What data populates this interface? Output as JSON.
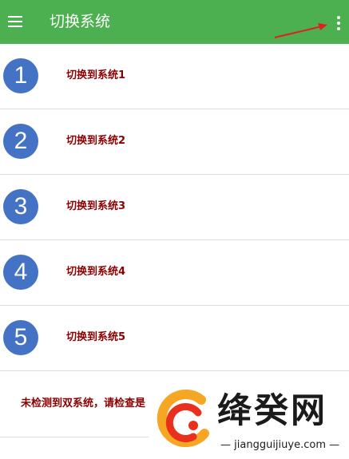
{
  "appbar": {
    "title": "切换系统",
    "menu_icon": "menu-icon",
    "overflow_icon": "more-vert-icon",
    "color": "#4caf50"
  },
  "list": {
    "items": [
      {
        "number": "1",
        "label": "切换到系统1"
      },
      {
        "number": "2",
        "label": "切换到系统2"
      },
      {
        "number": "3",
        "label": "切换到系统3"
      },
      {
        "number": "4",
        "label": "切换到系统4"
      },
      {
        "number": "5",
        "label": "切换到系统5"
      }
    ],
    "circle_color": "#4472c4",
    "label_color": "#8b0000"
  },
  "notice": {
    "text": "未检测到双系统，请检查是"
  },
  "watermark": {
    "name": "绛癸网",
    "url": "jiangguijiuye.com"
  }
}
